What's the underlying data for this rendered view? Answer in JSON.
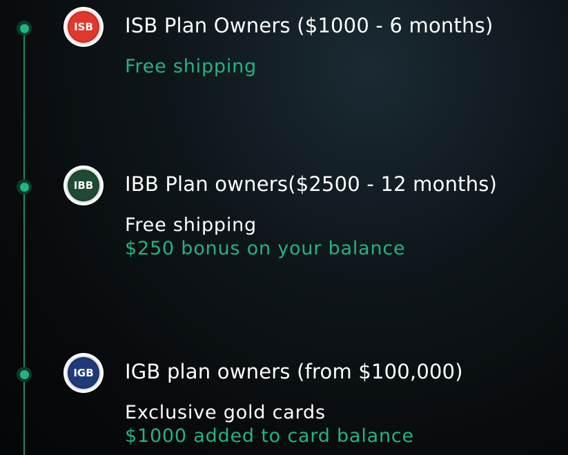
{
  "colors": {
    "accent_green": "#22b482",
    "timeline": "#1c8a63",
    "badge_isb": "#e1382c",
    "badge_ibb": "#1f4a33",
    "badge_igb": "#1e3a78"
  },
  "tiers": [
    {
      "badge": "ISB",
      "title": "ISB Plan Owners ($1000 - 6 months)",
      "benefits": [
        "Free shipping"
      ]
    },
    {
      "badge": "IBB",
      "title": "IBB Plan owners($2500 - 12 months)",
      "benefits": [
        "Free shipping",
        "$250 bonus on your balance"
      ]
    },
    {
      "badge": "IGB",
      "title": "IGB plan owners (from $100,000)",
      "benefits": [
        "Exclusive gold cards",
        "$1000 added to card balance"
      ]
    }
  ]
}
